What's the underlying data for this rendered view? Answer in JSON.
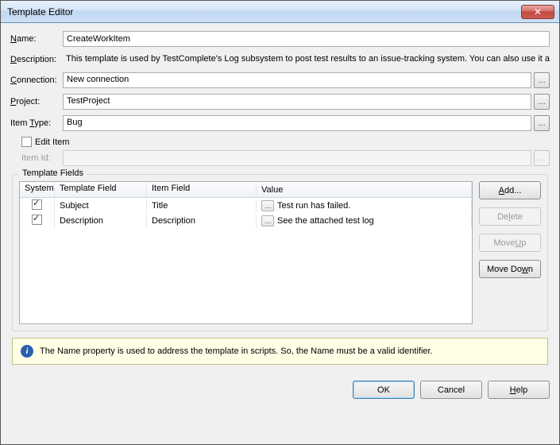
{
  "window": {
    "title": "Template Editor"
  },
  "form": {
    "name_label_pre": "N",
    "name_label_post": "ame:",
    "name_value": "CreateWorkItem",
    "desc_label_pre": "D",
    "desc_label_post": "escription:",
    "desc_value": "This template is used by TestComplete's Log subsystem to post test results to an issue-tracking system. You can also use it at yo",
    "conn_label_pre": "C",
    "conn_label_post": "onnection:",
    "conn_value": "New connection",
    "project_label_pre": "P",
    "project_label_post": "roject:",
    "project_value": "TestProject",
    "item_type_label": "Item ",
    "item_type_label_ul": "T",
    "item_type_label_post": "ype:",
    "item_type_value": "Bug",
    "edit_item_pre": "Edit Ite",
    "edit_item_ul": "m",
    "item_id_label": "Item ",
    "item_id_ul": "I",
    "item_id_post": "d:"
  },
  "template_fields": {
    "legend": "Template Fields",
    "headers": {
      "system": "System",
      "template": "Template Field",
      "item": "Item Field",
      "value": "Value"
    },
    "rows": [
      {
        "system": true,
        "template": "Subject",
        "item": "Title",
        "value": "Test run has failed."
      },
      {
        "system": true,
        "template": "Description",
        "item": "Description",
        "value": "See the attached test log"
      }
    ],
    "buttons": {
      "add_ul": "A",
      "add_post": "dd...",
      "delete_pre": "De",
      "delete_ul": "l",
      "delete_post": "ete",
      "move_up": "Move ",
      "move_up_ul": "U",
      "move_up_post": "p",
      "move_down_pre": "Move Do",
      "move_down_ul": "w",
      "move_down_post": "n"
    }
  },
  "info": {
    "text": "The Name property is used to address the template in scripts. So, the Name must be a valid identifier."
  },
  "footer": {
    "ok": "OK",
    "cancel": "Cancel",
    "help_ul": "H",
    "help_post": "elp"
  }
}
